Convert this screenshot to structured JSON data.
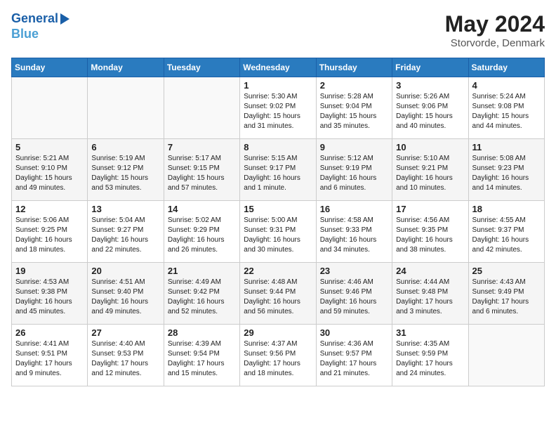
{
  "header": {
    "logo_line1": "General",
    "logo_line2": "Blue",
    "month_year": "May 2024",
    "location": "Storvorde, Denmark"
  },
  "weekdays": [
    "Sunday",
    "Monday",
    "Tuesday",
    "Wednesday",
    "Thursday",
    "Friday",
    "Saturday"
  ],
  "weeks": [
    [
      {
        "day": "",
        "sunrise": "",
        "sunset": "",
        "daylight": ""
      },
      {
        "day": "",
        "sunrise": "",
        "sunset": "",
        "daylight": ""
      },
      {
        "day": "",
        "sunrise": "",
        "sunset": "",
        "daylight": ""
      },
      {
        "day": "1",
        "sunrise": "Sunrise: 5:30 AM",
        "sunset": "Sunset: 9:02 PM",
        "daylight": "Daylight: 15 hours and 31 minutes."
      },
      {
        "day": "2",
        "sunrise": "Sunrise: 5:28 AM",
        "sunset": "Sunset: 9:04 PM",
        "daylight": "Daylight: 15 hours and 35 minutes."
      },
      {
        "day": "3",
        "sunrise": "Sunrise: 5:26 AM",
        "sunset": "Sunset: 9:06 PM",
        "daylight": "Daylight: 15 hours and 40 minutes."
      },
      {
        "day": "4",
        "sunrise": "Sunrise: 5:24 AM",
        "sunset": "Sunset: 9:08 PM",
        "daylight": "Daylight: 15 hours and 44 minutes."
      }
    ],
    [
      {
        "day": "5",
        "sunrise": "Sunrise: 5:21 AM",
        "sunset": "Sunset: 9:10 PM",
        "daylight": "Daylight: 15 hours and 49 minutes."
      },
      {
        "day": "6",
        "sunrise": "Sunrise: 5:19 AM",
        "sunset": "Sunset: 9:12 PM",
        "daylight": "Daylight: 15 hours and 53 minutes."
      },
      {
        "day": "7",
        "sunrise": "Sunrise: 5:17 AM",
        "sunset": "Sunset: 9:15 PM",
        "daylight": "Daylight: 15 hours and 57 minutes."
      },
      {
        "day": "8",
        "sunrise": "Sunrise: 5:15 AM",
        "sunset": "Sunset: 9:17 PM",
        "daylight": "Daylight: 16 hours and 1 minute."
      },
      {
        "day": "9",
        "sunrise": "Sunrise: 5:12 AM",
        "sunset": "Sunset: 9:19 PM",
        "daylight": "Daylight: 16 hours and 6 minutes."
      },
      {
        "day": "10",
        "sunrise": "Sunrise: 5:10 AM",
        "sunset": "Sunset: 9:21 PM",
        "daylight": "Daylight: 16 hours and 10 minutes."
      },
      {
        "day": "11",
        "sunrise": "Sunrise: 5:08 AM",
        "sunset": "Sunset: 9:23 PM",
        "daylight": "Daylight: 16 hours and 14 minutes."
      }
    ],
    [
      {
        "day": "12",
        "sunrise": "Sunrise: 5:06 AM",
        "sunset": "Sunset: 9:25 PM",
        "daylight": "Daylight: 16 hours and 18 minutes."
      },
      {
        "day": "13",
        "sunrise": "Sunrise: 5:04 AM",
        "sunset": "Sunset: 9:27 PM",
        "daylight": "Daylight: 16 hours and 22 minutes."
      },
      {
        "day": "14",
        "sunrise": "Sunrise: 5:02 AM",
        "sunset": "Sunset: 9:29 PM",
        "daylight": "Daylight: 16 hours and 26 minutes."
      },
      {
        "day": "15",
        "sunrise": "Sunrise: 5:00 AM",
        "sunset": "Sunset: 9:31 PM",
        "daylight": "Daylight: 16 hours and 30 minutes."
      },
      {
        "day": "16",
        "sunrise": "Sunrise: 4:58 AM",
        "sunset": "Sunset: 9:33 PM",
        "daylight": "Daylight: 16 hours and 34 minutes."
      },
      {
        "day": "17",
        "sunrise": "Sunrise: 4:56 AM",
        "sunset": "Sunset: 9:35 PM",
        "daylight": "Daylight: 16 hours and 38 minutes."
      },
      {
        "day": "18",
        "sunrise": "Sunrise: 4:55 AM",
        "sunset": "Sunset: 9:37 PM",
        "daylight": "Daylight: 16 hours and 42 minutes."
      }
    ],
    [
      {
        "day": "19",
        "sunrise": "Sunrise: 4:53 AM",
        "sunset": "Sunset: 9:38 PM",
        "daylight": "Daylight: 16 hours and 45 minutes."
      },
      {
        "day": "20",
        "sunrise": "Sunrise: 4:51 AM",
        "sunset": "Sunset: 9:40 PM",
        "daylight": "Daylight: 16 hours and 49 minutes."
      },
      {
        "day": "21",
        "sunrise": "Sunrise: 4:49 AM",
        "sunset": "Sunset: 9:42 PM",
        "daylight": "Daylight: 16 hours and 52 minutes."
      },
      {
        "day": "22",
        "sunrise": "Sunrise: 4:48 AM",
        "sunset": "Sunset: 9:44 PM",
        "daylight": "Daylight: 16 hours and 56 minutes."
      },
      {
        "day": "23",
        "sunrise": "Sunrise: 4:46 AM",
        "sunset": "Sunset: 9:46 PM",
        "daylight": "Daylight: 16 hours and 59 minutes."
      },
      {
        "day": "24",
        "sunrise": "Sunrise: 4:44 AM",
        "sunset": "Sunset: 9:48 PM",
        "daylight": "Daylight: 17 hours and 3 minutes."
      },
      {
        "day": "25",
        "sunrise": "Sunrise: 4:43 AM",
        "sunset": "Sunset: 9:49 PM",
        "daylight": "Daylight: 17 hours and 6 minutes."
      }
    ],
    [
      {
        "day": "26",
        "sunrise": "Sunrise: 4:41 AM",
        "sunset": "Sunset: 9:51 PM",
        "daylight": "Daylight: 17 hours and 9 minutes."
      },
      {
        "day": "27",
        "sunrise": "Sunrise: 4:40 AM",
        "sunset": "Sunset: 9:53 PM",
        "daylight": "Daylight: 17 hours and 12 minutes."
      },
      {
        "day": "28",
        "sunrise": "Sunrise: 4:39 AM",
        "sunset": "Sunset: 9:54 PM",
        "daylight": "Daylight: 17 hours and 15 minutes."
      },
      {
        "day": "29",
        "sunrise": "Sunrise: 4:37 AM",
        "sunset": "Sunset: 9:56 PM",
        "daylight": "Daylight: 17 hours and 18 minutes."
      },
      {
        "day": "30",
        "sunrise": "Sunrise: 4:36 AM",
        "sunset": "Sunset: 9:57 PM",
        "daylight": "Daylight: 17 hours and 21 minutes."
      },
      {
        "day": "31",
        "sunrise": "Sunrise: 4:35 AM",
        "sunset": "Sunset: 9:59 PM",
        "daylight": "Daylight: 17 hours and 24 minutes."
      },
      {
        "day": "",
        "sunrise": "",
        "sunset": "",
        "daylight": ""
      }
    ]
  ]
}
